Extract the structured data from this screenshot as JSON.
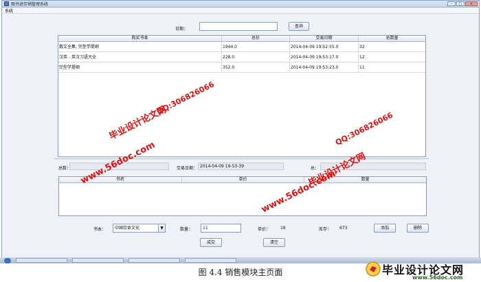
{
  "window": {
    "title": "图书进存销管理系统",
    "controls": [
      "–",
      "□",
      "×"
    ]
  },
  "menubar": {
    "items": [
      "系统"
    ]
  },
  "search": {
    "date_label": "日期：",
    "date_value": "",
    "query_button": "查询"
  },
  "purchase_table": {
    "columns": [
      "购买书本",
      "总价",
      "交易日期",
      "总数量"
    ],
    "rows": [
      [
        "散文全集, 完型学提纲",
        "1944.0",
        "2014-04-09 19:52:55.0",
        "32"
      ],
      [
        "汉英 - 英汉习语大全",
        "228.0",
        "2014-04-09 19:53:17.0",
        "12"
      ],
      [
        "完型学提纲",
        "352.0",
        "2014-04-09 19:53:23.0",
        "11"
      ]
    ]
  },
  "summary": {
    "total_label": "总数：",
    "total_value": "",
    "date_label": "交易日期：",
    "date_value": "2014-04-09 19-53-39",
    "sum_label": "总：",
    "sum_value": ""
  },
  "detail_table": {
    "columns": [
      "书名",
      "单价",
      "数量"
    ]
  },
  "form": {
    "book_label": "书本：",
    "book_value": "中国饮食文化",
    "qty_label": "数量：",
    "qty_value": "11",
    "price_label": "单价：",
    "price_value": "18",
    "stock_label": "库存：",
    "stock_value": "673",
    "add_button": "添加",
    "delete_button": "删除",
    "deal_button": "成交",
    "clear_button": "清空"
  },
  "watermark": {
    "site": "www.56doc.com",
    "qq": "QQ:306826066",
    "brand": "毕业设计论文网",
    "color": "#e01010"
  },
  "caption": "图 4.4 销售模块主页面",
  "logo": {
    "brand": "毕业设计论文网",
    "url": "www.56doc.com"
  }
}
